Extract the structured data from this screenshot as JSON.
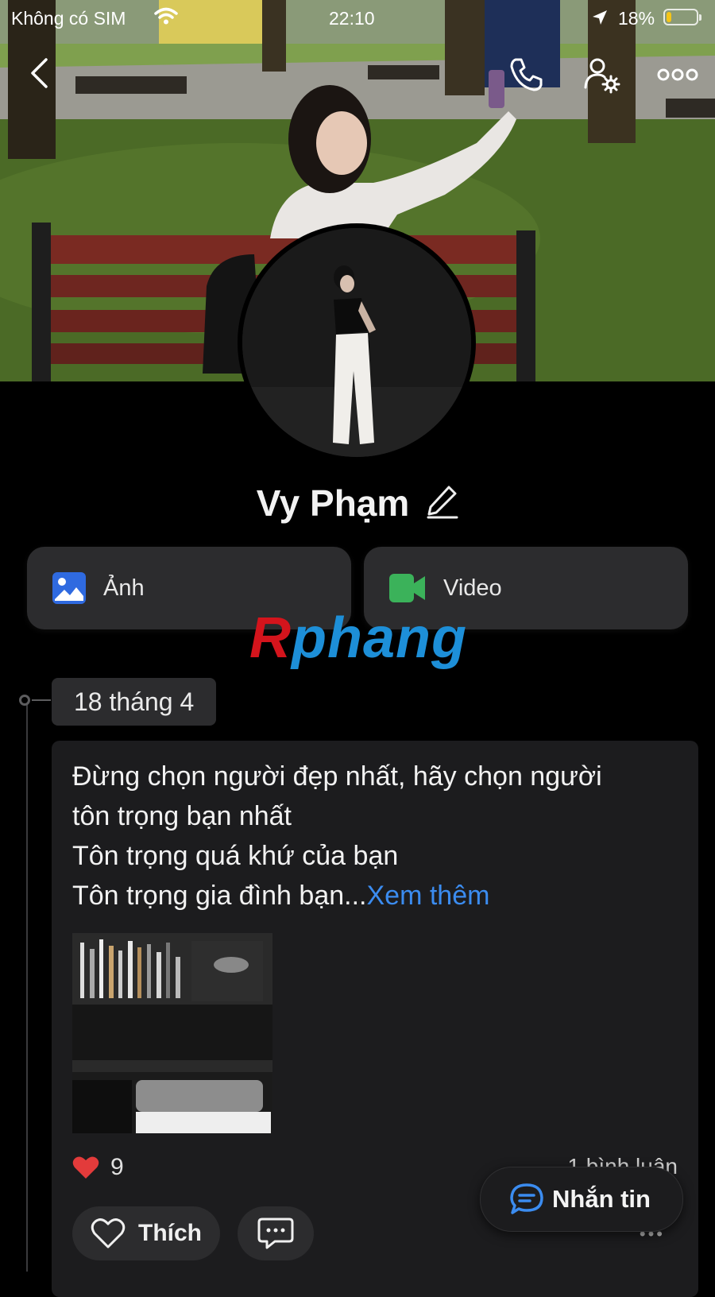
{
  "status_bar": {
    "carrier": "Không có SIM",
    "time": "22:10",
    "battery": "18%",
    "battery_level": 0.18,
    "battery_color": "#f5c518"
  },
  "top_bar": {
    "back_icon": "chevron-left-icon",
    "call_icon": "phone-icon",
    "settings_icon": "user-settings-icon",
    "more_icon": "more-horizontal-icon"
  },
  "profile": {
    "name": "Vy Phạm",
    "edit_icon": "pencil-icon"
  },
  "media": {
    "photo_label": "Ảnh",
    "video_label": "Video",
    "photo_icon_color": "#2f6ae0",
    "video_icon_color": "#3bb25a"
  },
  "watermark": {
    "part1": "R",
    "part2": "phang"
  },
  "timeline": {
    "date": "18 tháng 4",
    "post": {
      "lines": [
        "Đừng chọn người đẹp nhất, hãy chọn người",
        "tôn trọng bạn nhất",
        "Tôn trọng quá khứ của bạn",
        "Tôn trọng gia đình bạn..."
      ],
      "see_more": "Xem thêm",
      "like_count": "9",
      "comments": "1 bình luận",
      "like_label": "Thích",
      "more": "•••"
    }
  },
  "message_button": {
    "label": "Nhắn tin"
  },
  "colors": {
    "accent": "#3b8cf0",
    "background": "#000000",
    "card": "#1c1c1e"
  }
}
